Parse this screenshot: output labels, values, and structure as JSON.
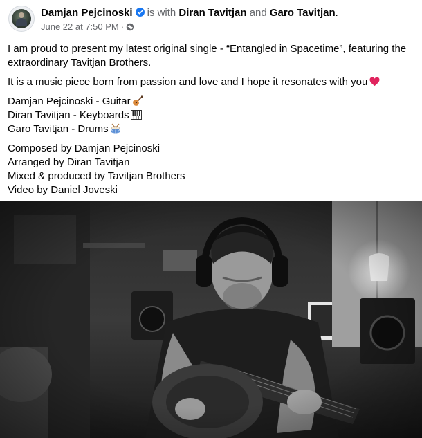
{
  "post": {
    "author": "Damjan Pejcinoski",
    "is_with_text": "is with",
    "with_1": "Diran Tavitjan",
    "and_text": "and",
    "with_2": "Garo Tavitjan",
    "period": ".",
    "timestamp": "June 22 at 7:50 PM",
    "separator": "·",
    "audience_icon": "globe-icon",
    "verified_icon": "verified-badge-icon",
    "verified_color": "#1877f2"
  },
  "body": {
    "intro": "I am proud to present my latest original single - “Entangled in Spacetime”, featuring the extraordinary Tavitjan Brothers.",
    "passion": "It is a music piece born from passion and love and I hope it resonates with you",
    "musicians": [
      {
        "text": "Damjan Pejcinoski - Guitar",
        "emoji": "guitar-emoji"
      },
      {
        "text": "Diran Tavitjan - Keyboards",
        "emoji": "keyboard-emoji"
      },
      {
        "text": "Garo Tavitjan - Drums",
        "emoji": "drum-emoji"
      }
    ],
    "credits": [
      "Composed by Damjan Pejcinoski",
      "Arranged by Diran Tavitjan",
      "Mixed & produced by Tavitjan Brothers",
      "Video by Daniel Joveski"
    ]
  },
  "media": {
    "type": "video-still",
    "subject": "guitarist-with-headphones"
  }
}
